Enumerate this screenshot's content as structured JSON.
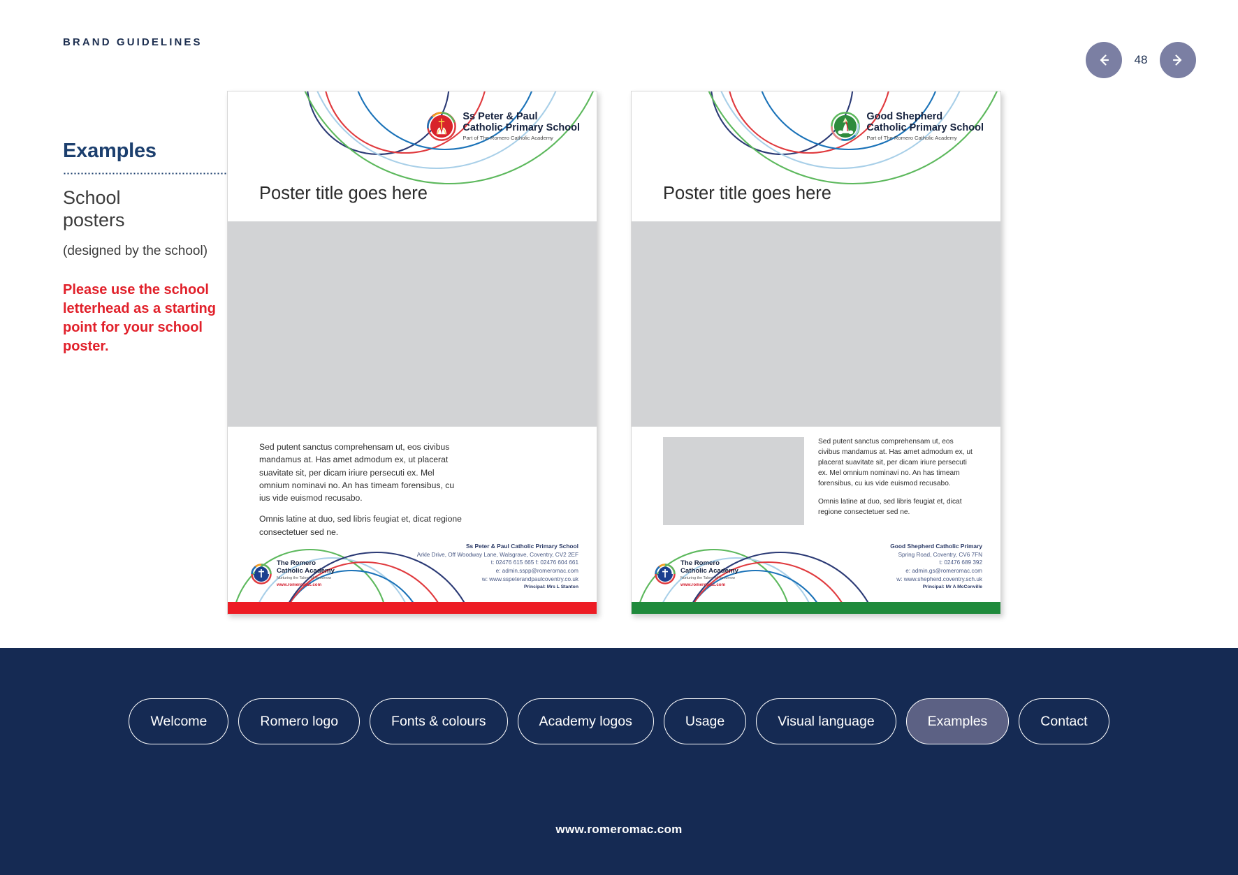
{
  "header": {
    "kicker": "BRAND GUIDELINES",
    "page_number": "48",
    "prev_icon": "arrow-left-icon",
    "next_icon": "arrow-right-icon"
  },
  "sidebar": {
    "title": "Examples",
    "subtitle_line1": "School",
    "subtitle_line2": "posters",
    "note": "(designed by the school)",
    "warning": "Please use the school letterhead as a starting point for your school poster.",
    "warning_color": "#e1202a"
  },
  "posters": [
    {
      "school_line1": "Ss Peter & Paul",
      "school_line2": "Catholic Primary School",
      "school_line3": "Part of The Romero Catholic Academy",
      "crest_icon": "ss-peter-paul-crest-icon",
      "title": "Poster title goes here",
      "body_paragraph_1": "Sed putent sanctus comprehensam ut, eos civibus mandamus at. Has amet admodum ex, ut placerat suavitate sit, per dicam iriure persecuti ex. Mel omnium nominavi no. An has timeam forensibus, cu ius vide euismod recusabo.",
      "body_paragraph_2": "Omnis latine at duo, sed libris feugiat et, dicat regione consectetuer sed ne.",
      "contact_name": "Ss Peter & Paul Catholic Primary School",
      "contact_address": "Arkle Drive, Off Woodway Lane, Walsgrave, Coventry, CV2 2EF",
      "contact_phone": "t: 02476 615 665   f: 02476 604 661",
      "contact_email": "e: admin.sspp@romeromac.com",
      "contact_web": "w: www.sspeterandpaulcoventry.co.uk",
      "contact_principal": "Principal: Mrs L Stanton",
      "accent_color": "#ed1c24",
      "has_image_placeholder": false
    },
    {
      "school_line1": "Good Shepherd",
      "school_line2": "Catholic Primary School",
      "school_line3": "Part of The Romero Catholic Academy",
      "crest_icon": "good-shepherd-crest-icon",
      "title": "Poster title goes here",
      "body_paragraph_1": "Sed putent sanctus comprehensam ut, eos civibus mandamus at. Has amet admodum ex, ut placerat suavitate sit, per dicam iriure persecuti ex. Mel omnium nominavi no. An has timeam forensibus, cu ius vide euismod recusabo.",
      "body_paragraph_2": "Omnis latine at duo, sed libris feugiat et, dicat regione consectetuer sed ne.",
      "contact_name": "Good Shepherd Catholic Primary",
      "contact_address": "Spring Road, Coventry, CV6 7FN",
      "contact_phone": "t: 02476 689 392",
      "contact_email": "e: admin.gs@romeromac.com",
      "contact_web": "w: www.shepherd.coventry.sch.uk",
      "contact_principal": "Principal: Mr A McConville",
      "accent_color": "#1f8a3c",
      "has_image_placeholder": true
    }
  ],
  "academy_logo": {
    "line1": "The Romero",
    "line2": "Catholic Academy",
    "line3": "Nurturing the Talent of Tomorrow",
    "line4": "www.romeromac.com",
    "crest_icon": "romero-academy-crest-icon"
  },
  "bottom_nav": {
    "items": [
      {
        "label": "Welcome",
        "active": false
      },
      {
        "label": "Romero logo",
        "active": false
      },
      {
        "label": "Fonts & colours",
        "active": false
      },
      {
        "label": "Academy logos",
        "active": false
      },
      {
        "label": "Usage",
        "active": false
      },
      {
        "label": "Visual language",
        "active": false
      },
      {
        "label": "Examples",
        "active": true
      },
      {
        "label": "Contact",
        "active": false
      }
    ],
    "url": "www.romeromac.com",
    "background_color": "#152a53"
  }
}
